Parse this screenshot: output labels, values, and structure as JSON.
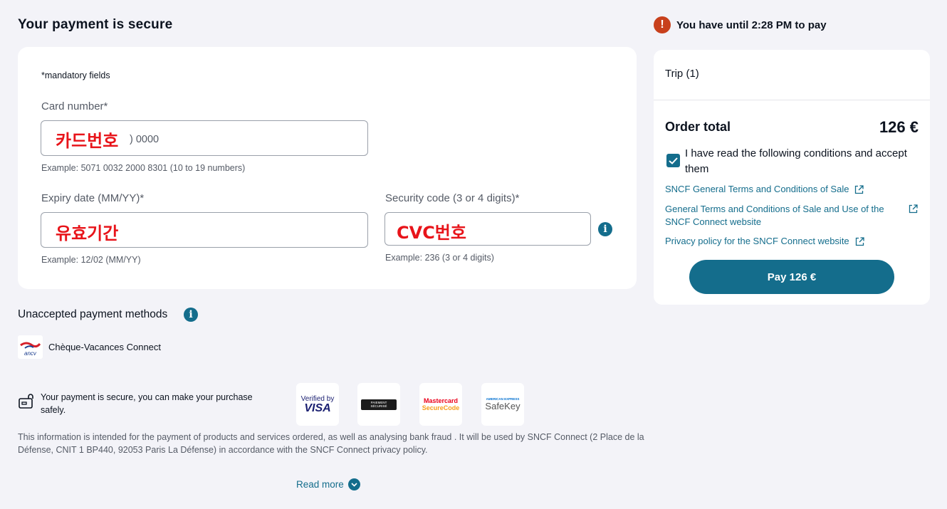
{
  "page": {
    "title": "Your payment is secure"
  },
  "form": {
    "mandatory_note": "*mandatory fields",
    "card_number": {
      "label": "Card number*",
      "overlay": "카드번호",
      "placeholder_visible": ") 0000",
      "hint": "Example: 5071 0032 2000 8301 (10 to 19 numbers)"
    },
    "expiry": {
      "label": "Expiry date (MM/YY)*",
      "overlay": "유효기간",
      "hint": "Example: 12/02 (MM/YY)"
    },
    "security_code": {
      "label": "Security code (3 or 4 digits)*",
      "overlay": "CVC번호",
      "hint": "Example: 236 (3 or 4 digits)",
      "info_icon": "i"
    }
  },
  "unaccepted": {
    "title": "Unaccepted payment methods",
    "info_icon": "i",
    "items": [
      {
        "label": "Chèque-Vacances Connect",
        "logo_text": "ancv"
      }
    ]
  },
  "secure": {
    "text": "Your payment is secure, you can make your purchase safely.",
    "badges": [
      {
        "line1": "Verified by",
        "line2": "VISA"
      },
      {
        "line1": "PAIEMENT",
        "line2": "SÉCURISÉ"
      },
      {
        "line1": "Mastercard",
        "line2": "SecureCode"
      },
      {
        "line1": "AMERICAN EXPRESS",
        "line2": "SafeKey"
      }
    ]
  },
  "disclaimer": "This information is intended for the payment of products and services ordered, as well as analysing bank fraud . It will be used by SNCF Connect (2 Place de la Défense, CNIT 1 BP440, 92053 Paris La Défense) in accordance with the SNCF Connect privacy policy.",
  "read_more": "Read more",
  "timer": {
    "icon": "!",
    "text": "You have until 2:28 PM to pay"
  },
  "summary": {
    "trip": "Trip (1)",
    "order_total_label": "Order total",
    "order_total_amount": "126 €",
    "accept_text": "I have read the following conditions and accept them",
    "links": [
      "SNCF General Terms and Conditions of Sale",
      "General Terms and Conditions of Sale and Use of the SNCF Connect website",
      "Privacy policy for the SNCF Connect website"
    ],
    "pay_button": "Pay 126 €"
  },
  "colors": {
    "accent": "#146d8c",
    "alert": "#c8401c",
    "overlay_red": "#e8141a",
    "background": "#f3f3f8"
  }
}
